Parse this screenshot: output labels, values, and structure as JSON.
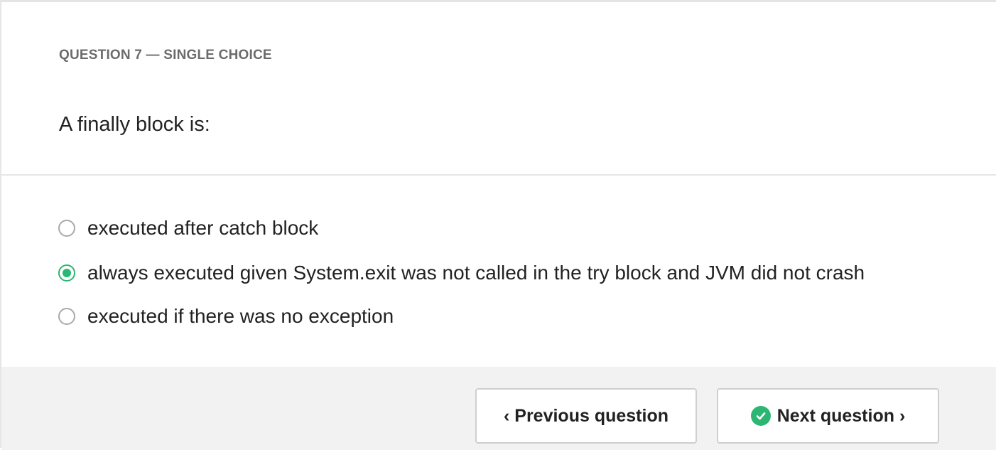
{
  "question": {
    "label": "QUESTION 7 — SINGLE CHOICE",
    "text": "A finally block is:"
  },
  "options": [
    {
      "label": "executed after catch block",
      "selected": false
    },
    {
      "label": "always executed given System.exit was not called in the try block and JVM did not crash",
      "selected": true
    },
    {
      "label": "executed if there was no exception",
      "selected": false
    }
  ],
  "navigation": {
    "previous_label": "‹ Previous question",
    "next_label": "Next question ›",
    "next_icon": "check-circle-icon"
  },
  "colors": {
    "accent": "#2bb673",
    "footer_bg": "#f2f2f2",
    "label_gray": "#6b6b6b"
  }
}
